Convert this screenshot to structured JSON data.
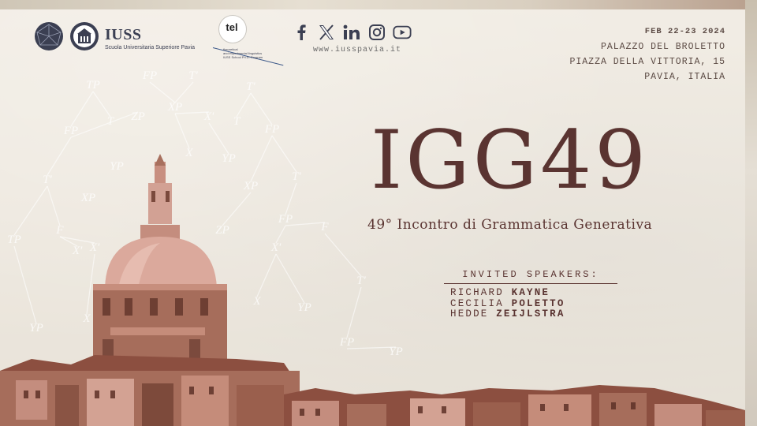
{
  "header": {
    "institution_name": "IUSS",
    "institution_subtitle": "Scuola Universitaria Superiore Pavia",
    "tel_badge": "tel",
    "tel_caption_lines": [
      "theoretical",
      "and experimental linguistics",
      "IUSS School Ph.D. Program"
    ],
    "social_icons": [
      "facebook-icon",
      "x-icon",
      "linkedin-icon",
      "instagram-icon",
      "youtube-icon"
    ],
    "website": "www.iusspavia.it"
  },
  "event": {
    "date": "FEB 22-23 2024",
    "venue": "PALAZZO DEL BROLETTO",
    "address": "PIAZZA DELLA VITTORIA, 15",
    "city": "PAVIA, ITALIA"
  },
  "main": {
    "title": "IGG49",
    "subtitle": "49° Incontro di Grammatica Generativa"
  },
  "speakers": {
    "heading": "INVITED SPEAKERS:",
    "list": [
      {
        "first": "RICHARD",
        "last": "KAYNE"
      },
      {
        "first": "CECILIA",
        "last": "POLETTO"
      },
      {
        "first": "HEDDE",
        "last": "ZEIJLSTRA"
      }
    ]
  },
  "background": {
    "tree_labels": [
      "TP",
      "FP",
      "T'",
      "YP",
      "XP",
      "X'",
      "ZP",
      "X",
      "F",
      "T"
    ]
  },
  "colors": {
    "title": "#5a3431",
    "text": "#5b4a44",
    "dome": "#d5a69a",
    "brick": "#a8705e",
    "roof": "#8c4f40"
  }
}
